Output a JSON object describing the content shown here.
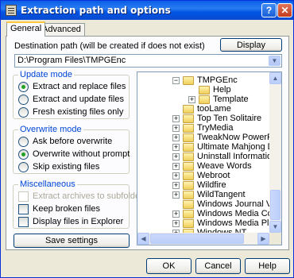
{
  "window": {
    "title": "Extraction path and options",
    "help_button": "?",
    "close_button": "✕"
  },
  "tabs": [
    {
      "label": "General",
      "active": true
    },
    {
      "label": "Advanced",
      "active": false
    }
  ],
  "destination": {
    "label": "Destination path (will be created if does not exist)",
    "display_button": "Display",
    "path_value": "D:\\Program Files\\TMPGEnc"
  },
  "update_mode": {
    "title": "Update mode",
    "options": [
      {
        "label": "Extract and replace files",
        "selected": true
      },
      {
        "label": "Extract and update files",
        "selected": false
      },
      {
        "label": "Fresh existing files only",
        "selected": false
      }
    ]
  },
  "overwrite_mode": {
    "title": "Overwrite mode",
    "options": [
      {
        "label": "Ask before overwrite",
        "selected": false
      },
      {
        "label": "Overwrite without prompt",
        "selected": true
      },
      {
        "label": "Skip existing files",
        "selected": false
      }
    ]
  },
  "miscellaneous": {
    "title": "Miscellaneous",
    "options": [
      {
        "label": "Extract archives to subfolders",
        "checked": false,
        "disabled": true
      },
      {
        "label": "Keep broken files",
        "checked": false,
        "disabled": false
      },
      {
        "label": "Display files in Explorer",
        "checked": false,
        "disabled": false
      }
    ]
  },
  "save_settings_button": "Save settings",
  "folder_tree": [
    {
      "label": "TMPGEnc",
      "expander": "−"
    },
    {
      "label": "Help",
      "expander": ""
    },
    {
      "label": "Template",
      "expander": "+"
    },
    {
      "label": "tooLame",
      "expander": ""
    },
    {
      "label": "Top Ten Solitaire",
      "expander": "+"
    },
    {
      "label": "TryMedia",
      "expander": "+"
    },
    {
      "label": "TweakNow PowerPa",
      "expander": "+"
    },
    {
      "label": "Ultimate Mahjong De",
      "expander": "+"
    },
    {
      "label": "Uninstall Information",
      "expander": "+"
    },
    {
      "label": "Weave Words",
      "expander": "+"
    },
    {
      "label": "Webroot",
      "expander": "+"
    },
    {
      "label": "Wildfire",
      "expander": "+"
    },
    {
      "label": "WildTangent",
      "expander": "+"
    },
    {
      "label": "Windows Journal Vie",
      "expander": ""
    },
    {
      "label": "Windows Media Com",
      "expander": "+"
    },
    {
      "label": "Windows Media Play",
      "expander": "+"
    },
    {
      "label": "Windows NT",
      "expander": "+"
    }
  ],
  "footer": {
    "ok": "OK",
    "cancel": "Cancel",
    "help": "Help"
  },
  "icons": {
    "dropdown": "▼",
    "scroll_up": "▲",
    "scroll_down": "▼",
    "scroll_left": "◀",
    "scroll_right": "▶"
  }
}
